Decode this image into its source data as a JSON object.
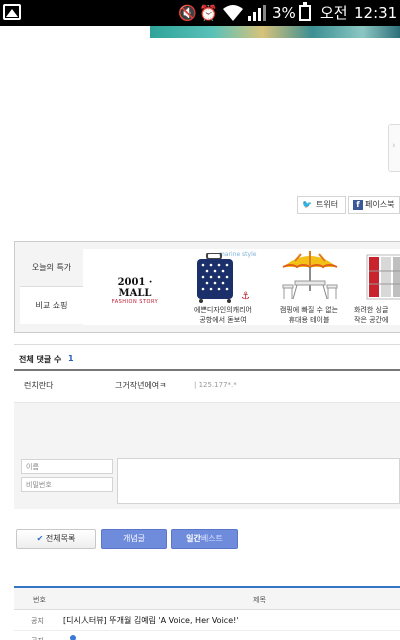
{
  "status_bar": {
    "battery": "3%",
    "ampm": "오전",
    "time": "12:31"
  },
  "share": {
    "twitter_label": "트위터",
    "facebook_label": "페이스북"
  },
  "shopping": {
    "tabs": [
      "오늘의 특가",
      "비교 쇼핑"
    ],
    "brand_main": "2001 · MALL",
    "brand_sub": "FASHION STORY",
    "brand_tag": "marine style",
    "products": [
      {
        "caption_line1": "에쁜디자인의캐리어",
        "caption_line2": "공항에서 돋보여"
      },
      {
        "caption_line1": "캠핑에 빠질 수 없는",
        "caption_line2": "휴대용 테이블"
      },
      {
        "caption_line1": "화려한 싱글",
        "caption_line2": "작은 공간에"
      }
    ]
  },
  "comments": {
    "title": "전체 댓글 수",
    "count": "1",
    "entry": {
      "author": "런치란다",
      "text": "그거작년에여ㅋ",
      "ip": "125.177*.*"
    },
    "name_placeholder": "이름",
    "password_placeholder": "비밀번호"
  },
  "buttons": {
    "list": "전체목록",
    "concept": "개념글",
    "daily_best_prefix": "일간",
    "daily_best_suffix": "베스트"
  },
  "table": {
    "col_number": "번호",
    "col_title": "제목",
    "rows": [
      {
        "type": "공지",
        "title": "[디시人터뷰] 뚜개월 김예림 'A Voice, Her Voice!'"
      },
      {
        "type": "공지",
        "title": ""
      }
    ]
  }
}
